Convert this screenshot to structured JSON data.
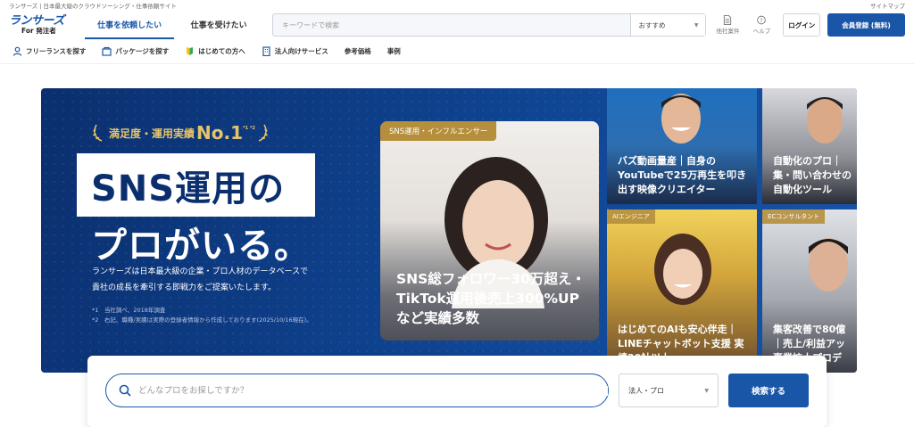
{
  "topbar": {
    "tagline": "ランサーズ | 日本最大級のクラウドソーシング・仕事依頼サイト",
    "sitemap": "サイトマップ"
  },
  "logo": {
    "brand": "ランサーズ",
    "sub": "For 発注者"
  },
  "mode_tabs": [
    {
      "label": "仕事を依頼したい",
      "active": true
    },
    {
      "label": "仕事を受けたい",
      "active": false
    }
  ],
  "search": {
    "placeholder": "キーワードで検索",
    "sort_value": "おすすめ"
  },
  "header_icons": [
    {
      "icon": "document-icon",
      "label": "他社案件"
    },
    {
      "icon": "help-icon",
      "label": "ヘルプ"
    }
  ],
  "login_label": "ログイン",
  "register_label": "会員登録 (無料)",
  "subnav": [
    {
      "icon": "person-icon",
      "label": "フリーランスを探す"
    },
    {
      "icon": "package-icon",
      "label": "パッケージを探す"
    },
    {
      "icon": "beginner-icon",
      "label": "はじめての方へ"
    },
    {
      "icon": "building-icon",
      "label": "法人向けサービス"
    },
    {
      "icon": "",
      "label": "参考価格"
    },
    {
      "icon": "",
      "label": "事例"
    }
  ],
  "hero": {
    "award_text": "満足度・運用実績",
    "award_no1": "No.1",
    "award_marks": "*1 *2",
    "headline_line1": "SNS運用の",
    "headline_line2": "プロがいる。",
    "desc_line1": "ランサーズは日本最大級の企業・プロ人材のデータベースで",
    "desc_line2": "貴社の成長を牽引する即戦力をご提案いたします。",
    "note1": "*1　当社調べ、2018年調査",
    "note2": "*2　右記、職種/実績は実際の登録者情報から作成しております(2025/10/16現在)。",
    "main_card": {
      "tag": "SNS運用・インフルエンサー",
      "text": "SNS総フォロワー30万超え・TikTok運用後売上300%UPなど実績多数"
    },
    "tiles": [
      {
        "tag": "",
        "text": "バズ動画量産｜自身のYouTubeで25万再生を叩き出す映像クリエイター"
      },
      {
        "tag": "",
        "text": "自動化のプロ｜集・問い合わせの自動化ツール"
      },
      {
        "tag": "AIエンジニア",
        "text": "はじめてのAIも安心伴走｜LINEチャットボット支援 実績20社以上"
      },
      {
        "tag": "ECコンサルタント",
        "text": "集客改善で80億｜売上/利益アッ事業拡大プロデ"
      }
    ]
  },
  "pro_search": {
    "placeholder": "どんなプロをお探しですか？",
    "type_value": "法人・プロ",
    "button_label": "検索する"
  },
  "colors": {
    "brand": "#1a56a8",
    "hero_bg": "#0f4593",
    "gold": "#b58f3c"
  }
}
